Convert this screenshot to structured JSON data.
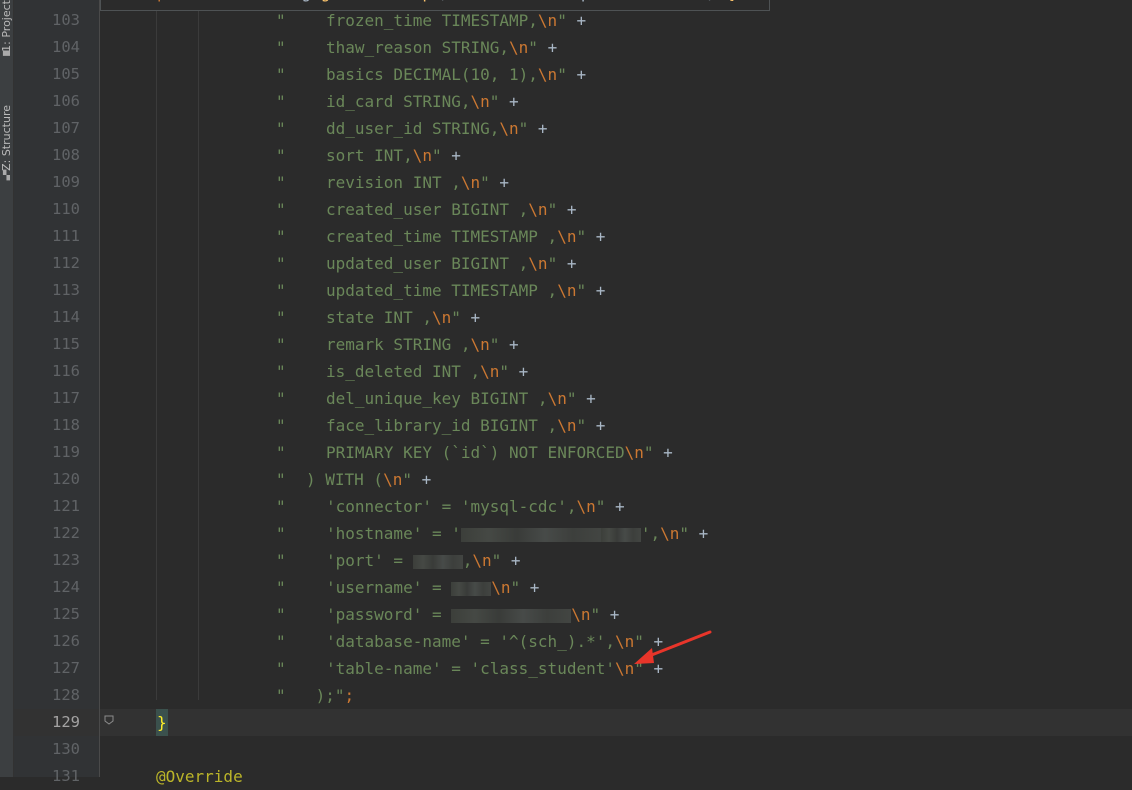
{
  "sidebar": {
    "tabs": [
      {
        "label": "1: Project",
        "icon": "folder-icon"
      },
      {
        "label": "Z: Structure",
        "icon": "structure-icon"
      }
    ]
  },
  "sticky_header": {
    "line_number": "",
    "text": "protected String getCreateSql(ParameterTool parameterTool) {"
  },
  "editor": {
    "current_line": 129,
    "lines": [
      {
        "num": "103",
        "body": "frozen_time TIMESTAMP,",
        "tail": "\" +"
      },
      {
        "num": "104",
        "body": "thaw_reason STRING,",
        "tail": "\" +"
      },
      {
        "num": "105",
        "body": "basics DECIMAL(10, 1),",
        "tail": "\" +"
      },
      {
        "num": "106",
        "body": "id_card STRING,",
        "tail": "\" +"
      },
      {
        "num": "107",
        "body": "dd_user_id STRING,",
        "tail": "\" +"
      },
      {
        "num": "108",
        "body": "sort INT,",
        "tail": "\" +"
      },
      {
        "num": "109",
        "body": "revision INT ,",
        "tail": "\" +"
      },
      {
        "num": "110",
        "body": "created_user BIGINT ,",
        "tail": "\" +"
      },
      {
        "num": "111",
        "body": "created_time TIMESTAMP ,",
        "tail": "\" +"
      },
      {
        "num": "112",
        "body": "updated_user BIGINT ,",
        "tail": "\" +"
      },
      {
        "num": "113",
        "body": "updated_time TIMESTAMP ,",
        "tail": "\" +"
      },
      {
        "num": "114",
        "body": "state INT ,",
        "tail": "\" +"
      },
      {
        "num": "115",
        "body": "remark STRING ,",
        "tail": "\" +"
      },
      {
        "num": "116",
        "body": "is_deleted INT ,",
        "tail": "\" +"
      },
      {
        "num": "117",
        "body": "del_unique_key BIGINT ,",
        "tail": "\" +"
      },
      {
        "num": "118",
        "body": "face_library_id BIGINT ,",
        "tail": "\" +"
      },
      {
        "num": "119",
        "body": "PRIMARY KEY (`id`) NOT ENFORCED",
        "tail": "\" +"
      },
      {
        "num": "120",
        "body": ") WITH (",
        "tail": "\" +"
      },
      {
        "num": "121",
        "body": "'connector' = 'mysql-cdc',",
        "tail": "\" +"
      },
      {
        "num": "122",
        "body": "'hostname' = '",
        "tail": "\" +"
      },
      {
        "num": "123",
        "body": "'port' = ",
        "tail": "\" +"
      },
      {
        "num": "124",
        "body": "'username' = ",
        "tail": "\" +"
      },
      {
        "num": "125",
        "body": "'password' = ",
        "tail": "\" +"
      },
      {
        "num": "126",
        "body": "'database-name' = '^(sch_).*',",
        "tail": "\" +"
      },
      {
        "num": "127",
        "body": "'table-name' = 'class_student'",
        "tail": "\" +"
      },
      {
        "num": "128",
        "body": ");\";",
        "tail": ""
      },
      {
        "num": "129",
        "body": "}",
        "tail": ""
      },
      {
        "num": "130",
        "body": "",
        "tail": ""
      },
      {
        "num": "131",
        "body": "@Override",
        "tail": ""
      }
    ],
    "escape": "\\n",
    "quote": "\""
  },
  "colors": {
    "background": "#2b2b2b",
    "string": "#6a8759",
    "keyword": "#cc7832",
    "annotation": "#bbb529",
    "arrow": "#e8352a"
  }
}
